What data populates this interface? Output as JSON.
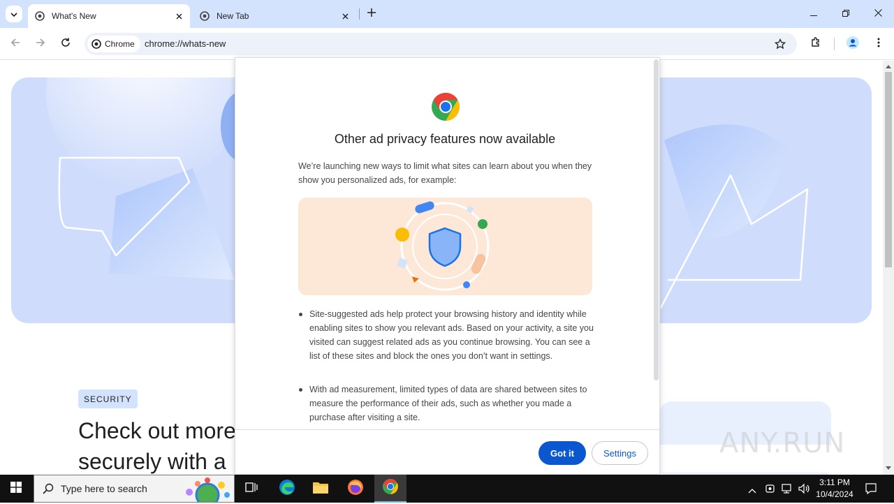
{
  "tabs": [
    {
      "title": "What's New",
      "active": true
    },
    {
      "title": "New Tab",
      "active": false
    }
  ],
  "toolbar": {
    "chip_label": "Chrome",
    "url": "chrome://whats-new"
  },
  "page": {
    "badge": "SECURITY",
    "headline_line1": "Check out more",
    "headline_line2": "securely with a"
  },
  "dialog": {
    "title": "Other ad privacy features now available",
    "intro": "We’re launching new ways to limit what sites can learn about you when they show you personalized ads, for example:",
    "bullets": [
      "Site-suggested ads help protect your browsing history and identity while enabling sites to show you relevant ads. Based on your activity, a site you visited can suggest related ads as you continue browsing. You can see a list of these sites and block the ones you don’t want in settings.",
      "With ad measurement, limited types of data are shared between sites to measure the performance of their ads, such as whether you made a purchase after visiting a site."
    ],
    "primary_button": "Got it",
    "secondary_button": "Settings"
  },
  "taskbar": {
    "search_placeholder": "Type here to search",
    "time": "3:11 PM",
    "date": "10/4/2024"
  },
  "watermark": "ANY.RUN",
  "colors": {
    "accent": "#0b57d0",
    "tabstrip": "#d3e3fd",
    "hero": "#cfdcfb",
    "illustration_bg": "#fde8d8"
  }
}
